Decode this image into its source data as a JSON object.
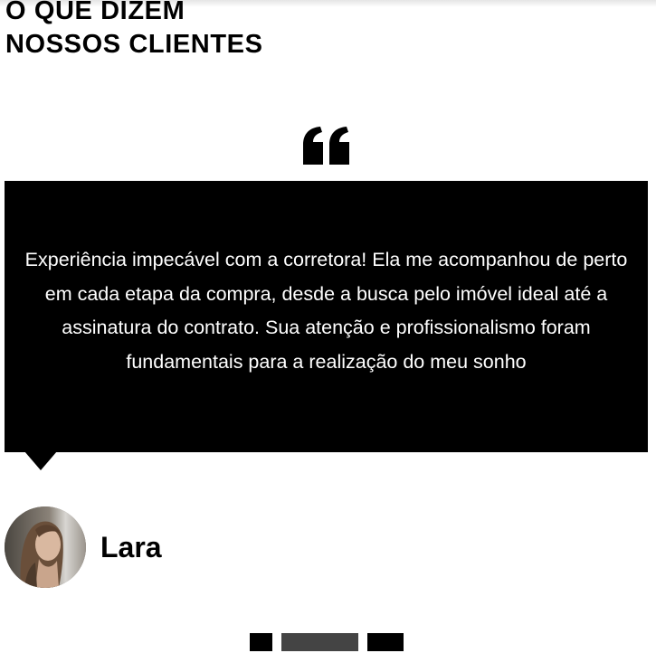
{
  "section": {
    "title_line1": "O QUE DIZEM",
    "title_line2": "NOSSOS CLIENTES"
  },
  "testimonial": {
    "quote_icon": "quote-left-icon",
    "text": "Experiência impecável com a corretora! Ela me acompanhou de perto em cada etapa da compra, desde a busca pelo imóvel ideal até a assinatura do contrato. Sua atenção e profissionalismo foram fundamentais para a realização do meu sonho",
    "author_name": "Lara",
    "avatar_alt": "Lara"
  },
  "pagination": {
    "total": 3,
    "active_index": 2
  },
  "colors": {
    "background": "#ffffff",
    "box": "#000000",
    "box_text": "#ffffff",
    "pager": "#000000",
    "pager_active": "#444444"
  }
}
